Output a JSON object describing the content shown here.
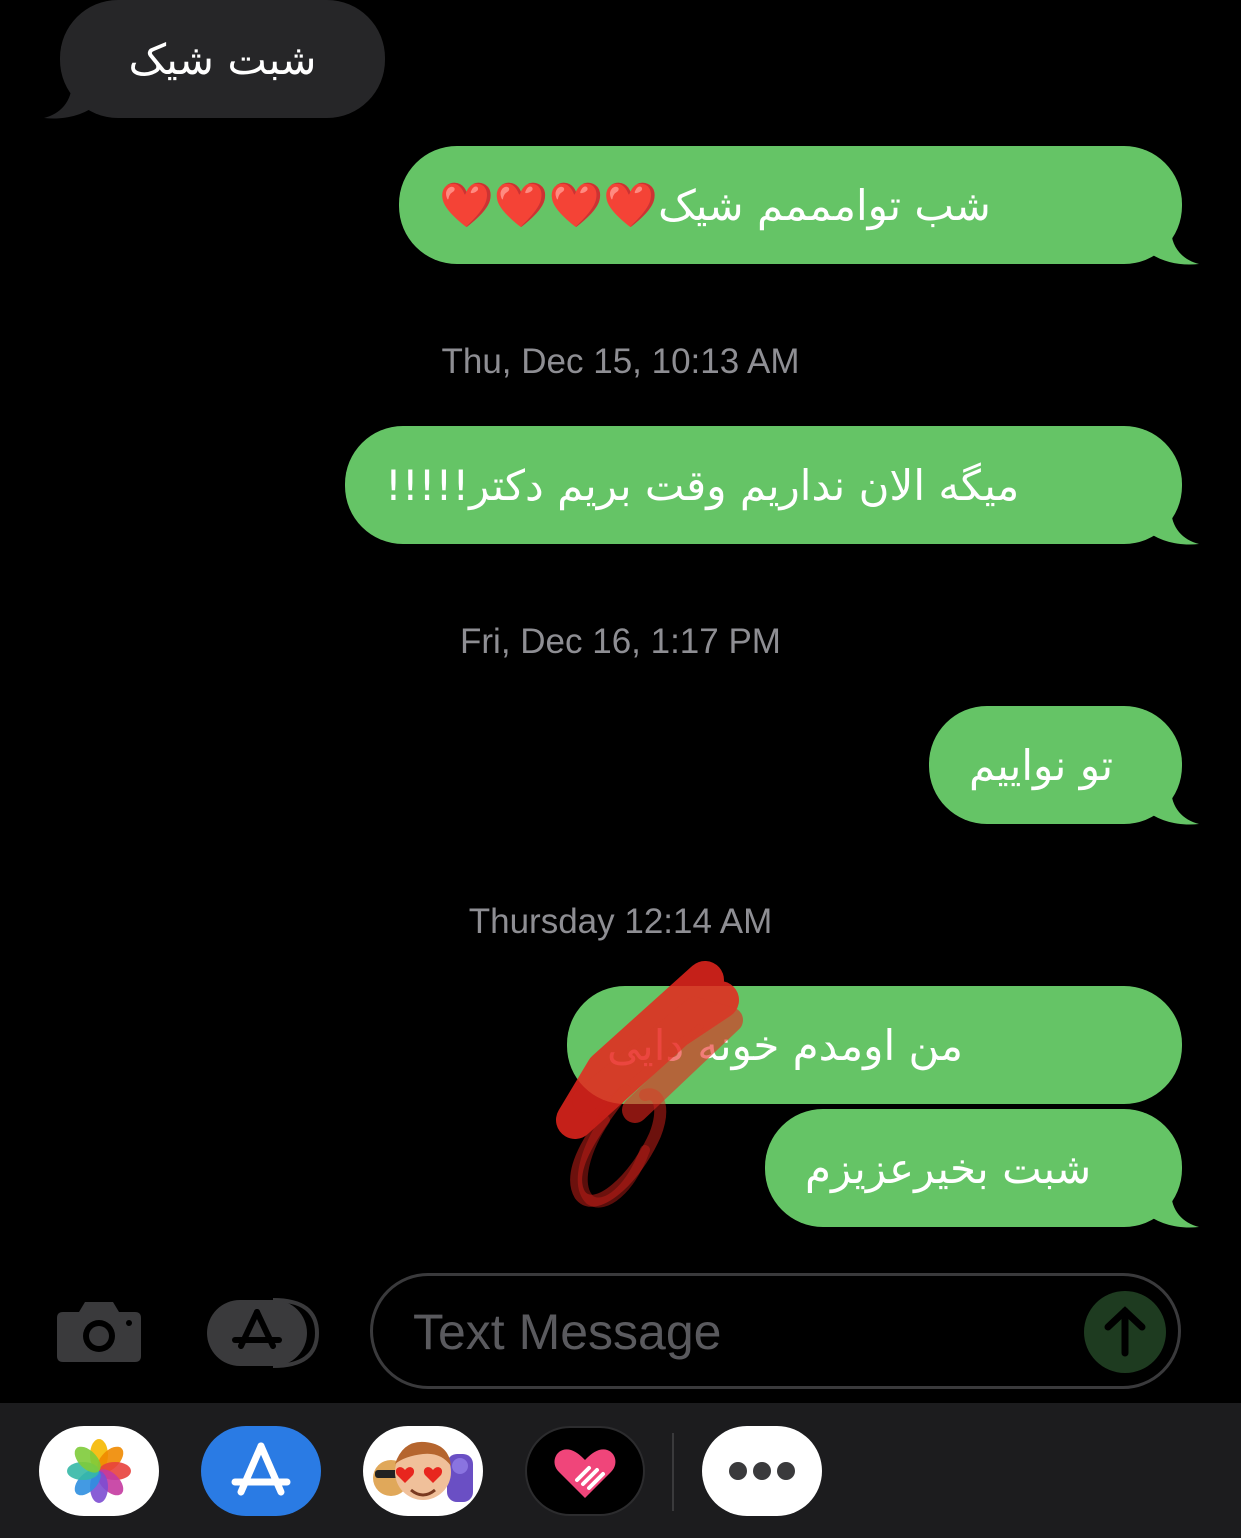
{
  "messages": [
    {
      "id": "m1",
      "direction": "received",
      "text": "شبت شیک"
    },
    {
      "id": "m2",
      "direction": "sent",
      "text": "شب توامممم شیک",
      "emoji": "❤️❤️❤️❤️"
    },
    {
      "id": "m3",
      "direction": "sent",
      "text": "میگه الان نداریم وقت بریم دکتر!!!!!"
    },
    {
      "id": "m4",
      "direction": "sent",
      "text": "تو نواییم"
    },
    {
      "id": "m5",
      "direction": "sent",
      "text": "من اومدم خونه دایی"
    },
    {
      "id": "m6",
      "direction": "sent",
      "text": "شبت بخیرعزیزم"
    }
  ],
  "timestamps": {
    "t1": "Thu, Dec 15, 10:13 AM",
    "t2": "Fri, Dec 16, 1:17 PM",
    "t3": "Thursday 12:14 AM"
  },
  "composer": {
    "placeholder": "Text Message",
    "camera_icon": "camera-icon",
    "apps_icon": "app-store-icon",
    "send_icon": "arrow-up-icon"
  },
  "app_drawer": {
    "apps": [
      "photos-icon",
      "app-store-icon",
      "memoji-icon",
      "digital-touch-icon",
      "more-icon"
    ]
  },
  "colors": {
    "sent_bubble": "#65c466",
    "received_bubble": "#262628",
    "background": "#000000",
    "timestamp": "#8e8e93",
    "redaction_scribble": "#e8261e"
  }
}
